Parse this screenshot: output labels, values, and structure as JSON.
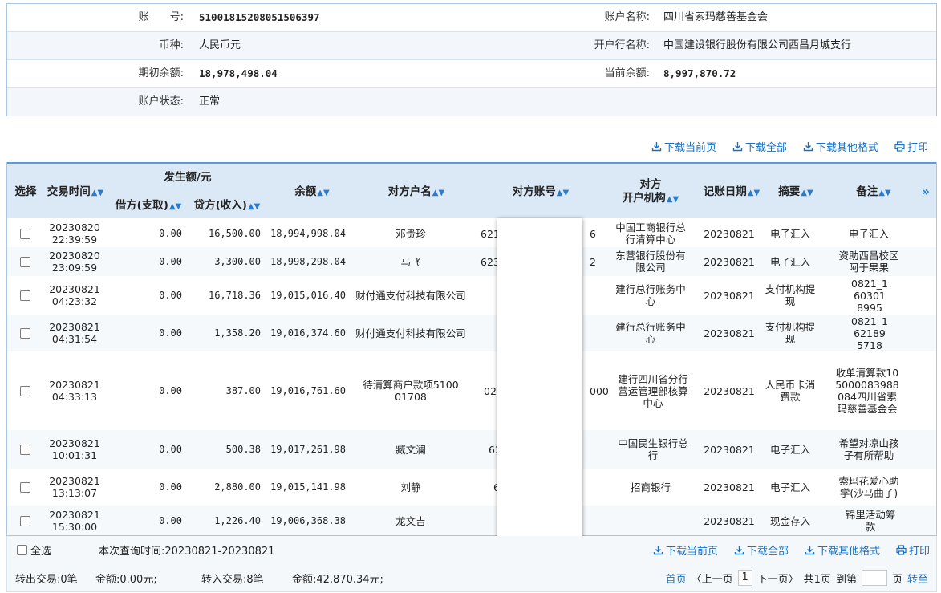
{
  "account": {
    "rows": [
      {
        "label1": "账　　号:",
        "value1": "51001815208051506397",
        "label2": "账户名称:",
        "value2": "四川省索玛慈善基金会"
      },
      {
        "label1": "币种:",
        "value1": "人民币元",
        "label2": "开户行名称:",
        "value2": "中国建设银行股份有限公司西昌月城支行"
      },
      {
        "label1": "期初余额:",
        "value1": "18,978,498.04",
        "label2": "当前余额:",
        "value2": "8,997,870.72"
      },
      {
        "label1": "账户状态:",
        "value1": "正常",
        "label2": "",
        "value2": ""
      }
    ]
  },
  "toolbar": {
    "download_page": "下载当前页",
    "download_all": "下载全部",
    "download_other": "下载其他格式",
    "print": "打印"
  },
  "table": {
    "headers": {
      "select": "选择",
      "time": "交易时间",
      "amount_group": "发生额/元",
      "debit": "借方(支取)",
      "credit": "贷方(收入)",
      "balance": "余额",
      "counter_name": "对方户名",
      "counter_account": "对方账号",
      "counter_bank_1": "对方",
      "counter_bank_2": "开户机构",
      "post_date": "记账日期",
      "summary": "摘要",
      "remark": "备注",
      "more": "»"
    },
    "rows": [
      {
        "time1": "20230820",
        "time2": "22:39:59",
        "debit": "0.00",
        "credit": "16,500.00",
        "balance": "18,994,998.04",
        "name": "邓贵珍",
        "acct_l": "621",
        "acct_r": "6",
        "bank": "中国工商银行总行清算中心",
        "date": "20230821",
        "summary": "电子汇入",
        "remark": "电子汇入"
      },
      {
        "time1": "20230820",
        "time2": "23:09:59",
        "debit": "0.00",
        "credit": "3,300.00",
        "balance": "18,998,298.04",
        "name": "马飞",
        "acct_l": "623",
        "acct_r": "2",
        "bank": "东营银行股份有限公司",
        "date": "20230821",
        "summary": "电子汇入",
        "remark": "资助西昌校区阿于果果"
      },
      {
        "time1": "20230821",
        "time2": "04:23:32",
        "debit": "0.00",
        "credit": "16,718.36",
        "balance": "19,015,016.40",
        "name": "财付通支付科技有限公司",
        "acct_l": "",
        "acct_r": "",
        "bank": "建行总行账务中心",
        "date": "20230821",
        "summary": "支付机构提现",
        "remark": "0821_1603018995"
      },
      {
        "time1": "20230821",
        "time2": "04:31:54",
        "debit": "0.00",
        "credit": "1,358.20",
        "balance": "19,016,374.60",
        "name": "财付通支付科技有限公司",
        "acct_l": "",
        "acct_r": "",
        "bank": "建行总行账务中心",
        "date": "20230821",
        "summary": "支付机构提现",
        "remark": "0821_1621895718"
      },
      {
        "time1": "20230821",
        "time2": "04:33:13",
        "debit": "0.00",
        "credit": "387.00",
        "balance": "19,016,761.60",
        "name": "待清算商户款项510001708",
        "acct_l": "029",
        "acct_r": "000",
        "bank": "建行四川省分行营运管理部核算中心",
        "date": "20230821",
        "summary": "人民币卡消费款",
        "remark": "收单清算款105000083988084四川省索玛慈善基金会"
      },
      {
        "time1": "20230821",
        "time2": "10:01:31",
        "debit": "0.00",
        "credit": "500.38",
        "balance": "19,017,261.98",
        "name": "臧文澜",
        "acct_l": "62",
        "acct_r": "",
        "bank": "中国民生银行总行",
        "date": "20230821",
        "summary": "电子汇入",
        "remark": "希望对凉山孩子有所帮助"
      },
      {
        "time1": "20230821",
        "time2": "13:13:07",
        "debit": "0.00",
        "credit": "2,880.00",
        "balance": "19,015,141.98",
        "name": "刘静",
        "acct_l": "62",
        "acct_r": "",
        "bank": "招商银行",
        "date": "20230821",
        "summary": "电子汇入",
        "remark": "索玛花爱心助学(沙马曲子)"
      },
      {
        "time1": "20230821",
        "time2": "15:30:00",
        "debit": "0.00",
        "credit": "1,226.40",
        "balance": "19,006,368.38",
        "name": "龙文吉",
        "acct_l": "",
        "acct_r": "",
        "bank": "",
        "date": "20230821",
        "summary": "现金存入",
        "remark": "锦里活动筹款"
      }
    ]
  },
  "footer": {
    "select_all": "全选",
    "query_time": "本次查询时间:20230821-20230821",
    "out_count": "转出交易:0笔",
    "out_amount": "金额:0.00元;",
    "in_count": "转入交易:8笔",
    "in_amount": "金额:42,870.34元;",
    "pager": {
      "first": "首页",
      "prev": "〈上一页",
      "current": "1",
      "next": "下一页〉",
      "total": "共1页",
      "goto_label": "到第",
      "page_unit": "页",
      "go": "转至"
    }
  }
}
